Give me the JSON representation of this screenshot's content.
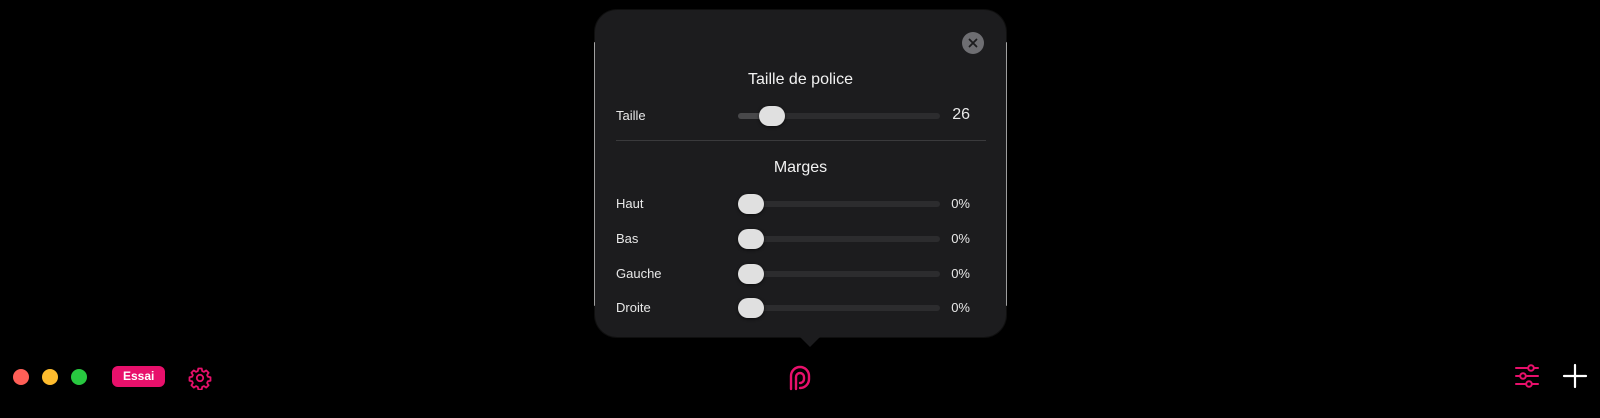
{
  "colors": {
    "accent": "#e8106b",
    "popover_bg": "#1c1c1e",
    "traffic_close": "#ff5f57",
    "traffic_minimize": "#febc2e",
    "traffic_maximize": "#28c840"
  },
  "toolbar": {
    "badge_label": "Essai",
    "icons": [
      "gear-icon",
      "app-logo-icon",
      "sliders-icon",
      "plus-icon"
    ]
  },
  "popover": {
    "font_section": {
      "title": "Taille de police",
      "size": {
        "label": "Taille",
        "value": "26",
        "level": 0.12
      }
    },
    "margins_section": {
      "title": "Marges",
      "rows": [
        {
          "label": "Haut",
          "value": "0%",
          "level": 0
        },
        {
          "label": "Bas",
          "value": "0%",
          "level": 0
        },
        {
          "label": "Gauche",
          "value": "0%",
          "level": 0
        },
        {
          "label": "Droite",
          "value": "0%",
          "level": 0
        }
      ]
    }
  }
}
